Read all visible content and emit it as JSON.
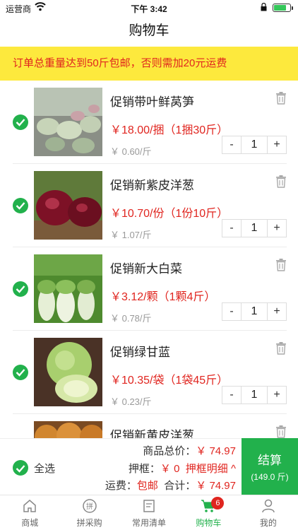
{
  "status_bar": {
    "carrier": "运营商",
    "time": "下午 3:42"
  },
  "nav": {
    "title": "购物车"
  },
  "notice": {
    "text": "订单总重量达到50斤包邮，否则需加20元运费"
  },
  "items": [
    {
      "name": "促销带叶鲜莴笋",
      "price": "￥18.00/捆（1捆30斤）",
      "unit_price": "￥ 0.60/斤",
      "qty": "1",
      "minus": "-",
      "plus": "+",
      "thumb": "lettuce-stem"
    },
    {
      "name": "促销新紫皮洋葱",
      "price": "￥10.70/份（1份10斤）",
      "unit_price": "￥ 1.07/斤",
      "qty": "1",
      "minus": "-",
      "plus": "+",
      "thumb": "red-onion"
    },
    {
      "name": "促销新大白菜",
      "price": "￥3.12/颗（1颗4斤）",
      "unit_price": "￥ 0.78/斤",
      "qty": "1",
      "minus": "-",
      "plus": "+",
      "thumb": "napa-cabbage"
    },
    {
      "name": "促销绿甘蓝",
      "price": "￥10.35/袋（1袋45斤）",
      "unit_price": "￥ 0.23/斤",
      "qty": "1",
      "minus": "-",
      "plus": "+",
      "thumb": "green-cabbage"
    },
    {
      "name": "促销新黄皮洋葱",
      "price": "",
      "unit_price": "",
      "qty": "",
      "minus": "",
      "plus": "",
      "thumb": "yellow-onion"
    }
  ],
  "summary": {
    "select_all": "全选",
    "total_label": "商品总价：",
    "total_value": "￥ 74.97",
    "crate_label": "押框：",
    "crate_value": "￥ 0",
    "crate_detail": "押框明细 ^",
    "shipping_label": "运费：",
    "shipping_value": "包邮",
    "sum_label": "合计：",
    "sum_value": "￥ 74.97"
  },
  "checkout": {
    "label": "结算",
    "weight": "(149.0 斤)"
  },
  "tabs": [
    {
      "label": "商城",
      "icon": "home-icon"
    },
    {
      "label": "拼采购",
      "icon": "group-buy-icon"
    },
    {
      "label": "常用清单",
      "icon": "list-icon"
    },
    {
      "label": "购物车",
      "icon": "cart-icon",
      "badge": "6",
      "active": true
    },
    {
      "label": "我的",
      "icon": "profile-icon"
    }
  ],
  "colors": {
    "accent": "#22b14c",
    "price": "#e0251f",
    "notice_bg": "#fde93d"
  }
}
